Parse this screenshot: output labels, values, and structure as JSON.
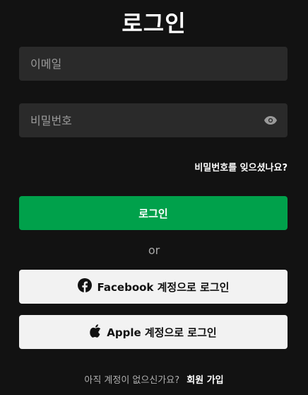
{
  "page": {
    "title": "로그인"
  },
  "form": {
    "email_placeholder": "이메일",
    "email_value": "",
    "password_placeholder": "비밀번호",
    "password_value": "",
    "forgot_password": "비밀번호를 잊으셨나요?",
    "login_button": "로그인"
  },
  "divider": {
    "text": "or"
  },
  "social": {
    "facebook_label": "Facebook 계정으로 로그인",
    "apple_label": "Apple 계정으로 로그인",
    "facebook_icon": "facebook-icon",
    "apple_icon": "apple-icon"
  },
  "footer": {
    "prompt": "아직 계정이 없으신가요?",
    "signup_link": "회원 가입"
  },
  "colors": {
    "background": "#121212",
    "input_background": "#2a2a2a",
    "primary": "#00a14b",
    "social_background": "#f2f2f2"
  }
}
